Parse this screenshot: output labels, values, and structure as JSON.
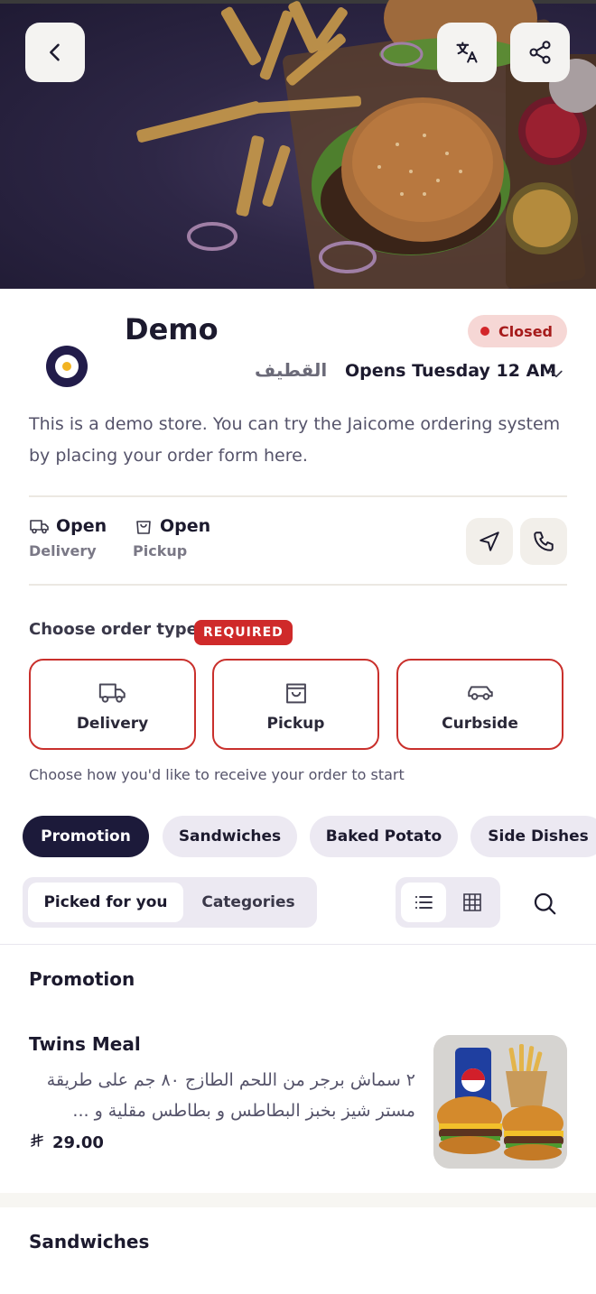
{
  "store": {
    "name": "Demo",
    "status": "Closed",
    "city": "القطيف",
    "opens": "Opens Tuesday 12 AM",
    "description": "This is a demo store. You can try the Jaicome ordering system by placing your order form here."
  },
  "services": [
    {
      "status": "Open",
      "label": "Delivery",
      "icon": "truck-icon"
    },
    {
      "status": "Open",
      "label": "Pickup",
      "icon": "bag-icon"
    }
  ],
  "order": {
    "label": "Choose order type",
    "required": "REQUIRED",
    "types": [
      "Delivery",
      "Pickup",
      "Curbside"
    ],
    "hint": "Choose how you'd like to receive your order to start"
  },
  "categories": [
    "Promotion",
    "Sandwiches",
    "Baked Potato",
    "Side Dishes"
  ],
  "view": {
    "picked": "Picked for you",
    "categories": "Categories"
  },
  "sections": {
    "promotion": "Promotion",
    "sandwiches": "Sandwiches"
  },
  "item": {
    "name": "Twins Meal",
    "description": "٢ سماش برجر من اللحم الطازج ٨٠ جم على طريقة مستر شيز بخبز البطاطس و بطاطس مقلية و ...",
    "price": "29.00",
    "currency_symbol": "⃁"
  },
  "colors": {
    "primary": "#1c1a3a",
    "accent_red": "#c9302c",
    "closed_bg": "#f6d7d5"
  }
}
